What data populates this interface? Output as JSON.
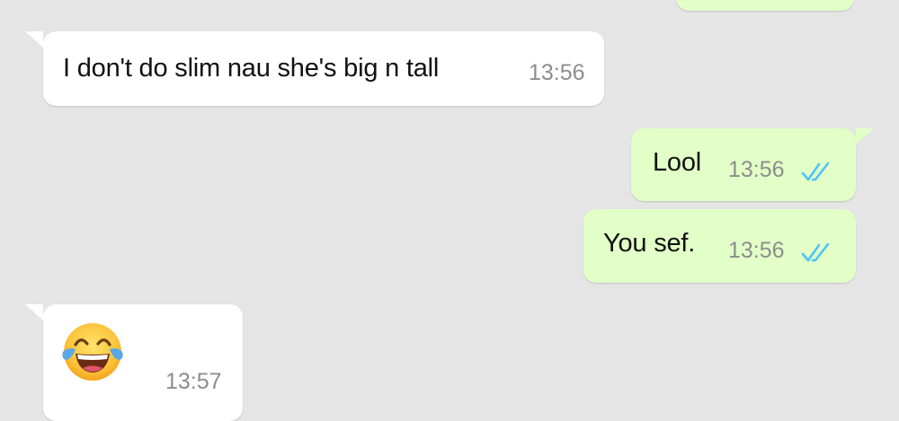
{
  "theme": {
    "background": "#e5e5e5",
    "incoming_bubble": "#ffffff",
    "outgoing_bubble": "#e2ffc7",
    "timestamp_color": "#8d8d8d",
    "read_tick_color": "#4fc3f7"
  },
  "messages": [
    {
      "direction": "incoming",
      "text": "I don't do slim nau she's big n tall",
      "time": "13:56"
    },
    {
      "direction": "outgoing",
      "text": "Lool",
      "time": "13:56",
      "status": "read",
      "status_icon": "double-check-icon"
    },
    {
      "direction": "outgoing",
      "text": "You sef.",
      "time": "13:56",
      "status": "read",
      "status_icon": "double-check-icon"
    },
    {
      "direction": "incoming",
      "emoji": "face-with-tears-of-joy",
      "time": "13:57"
    }
  ]
}
